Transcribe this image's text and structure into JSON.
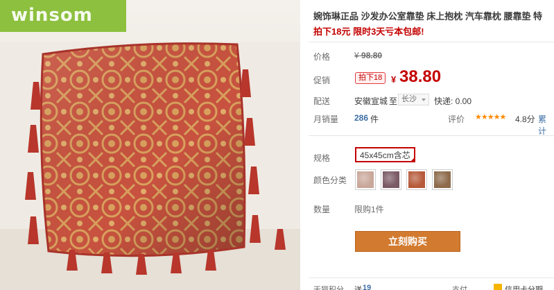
{
  "brand": {
    "logo_text": "winsom"
  },
  "product": {
    "title": "婉饰琳正品 沙发办公室靠垫 床上抱枕 汽车靠枕 腰靠垫 特",
    "promo": "拍下18元 限时3天亏本包邮!"
  },
  "price": {
    "label": "价格",
    "original_currency": "¥",
    "original": "98.80",
    "promo_label": "促销",
    "badge": "拍下18",
    "currency": "¥",
    "current": "38.80"
  },
  "shipping": {
    "label": "配送",
    "from": "安徽宣城",
    "to_word": "至",
    "city": "长沙",
    "express": "快递: 0.00"
  },
  "sales": {
    "label": "月销量",
    "count": "286",
    "unit": "件",
    "rating_label": "评价",
    "stars": "★★★★★",
    "score": "4.8分",
    "cumulative": "累计"
  },
  "spec": {
    "label": "规格",
    "selected": "45x45cm含芯"
  },
  "color": {
    "label": "颜色分类",
    "swatches": [
      {
        "name": "swatch-1",
        "color": "#c9a79a"
      },
      {
        "name": "swatch-2",
        "color": "#7a5a64"
      },
      {
        "name": "swatch-3",
        "color": "#b65a3a"
      },
      {
        "name": "swatch-4",
        "color": "#8c6a4a"
      }
    ]
  },
  "quantity": {
    "label": "数量",
    "limit": "限购1件"
  },
  "buy_button": "立刻购买",
  "bottom": {
    "points_label": "天猫积分",
    "points_prefix": "送",
    "points_value": "19",
    "pay_label": "支付",
    "card_label": "信用卡分期"
  },
  "colors": {
    "accent_red": "#c40000",
    "brand_green": "#8dc03f",
    "button_orange": "#d27a2f",
    "star_orange": "#ff8a00"
  },
  "icons": [
    "star-icon",
    "caret-down-icon",
    "credit-card-icon"
  ]
}
